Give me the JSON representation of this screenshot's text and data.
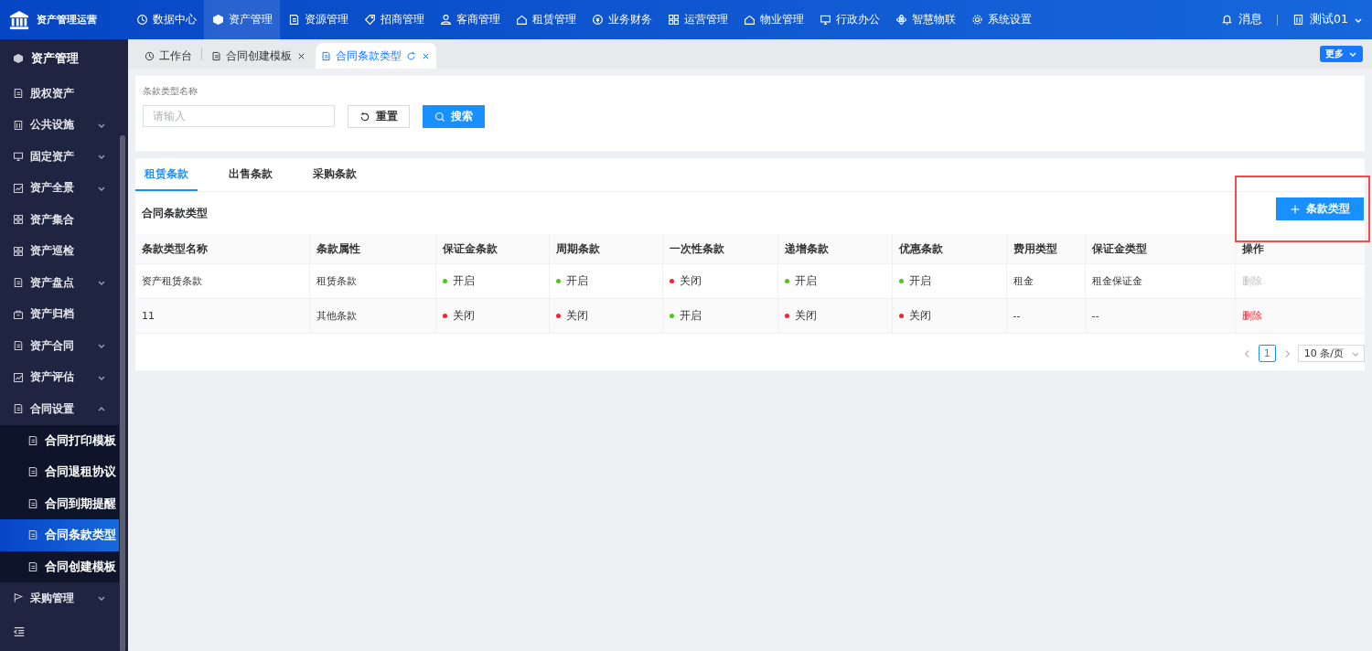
{
  "app": {
    "title": "资产管理运营"
  },
  "top_nav": [
    {
      "label": "数据中心",
      "selected": false
    },
    {
      "label": "资产管理",
      "selected": true
    },
    {
      "label": "资源管理",
      "selected": false
    },
    {
      "label": "招商管理",
      "selected": false
    },
    {
      "label": "客商管理",
      "selected": false
    },
    {
      "label": "租赁管理",
      "selected": false
    },
    {
      "label": "业务财务",
      "selected": false
    },
    {
      "label": "运营管理",
      "selected": false
    },
    {
      "label": "物业管理",
      "selected": false
    },
    {
      "label": "行政办公",
      "selected": false
    },
    {
      "label": "智慧物联",
      "selected": false
    },
    {
      "label": "系统设置",
      "selected": false
    }
  ],
  "header_right": {
    "messages": "消息",
    "user": "测试01"
  },
  "sidebar": {
    "title": "资产管理",
    "items": [
      {
        "label": "股权资产",
        "kind": "link"
      },
      {
        "label": "公共设施",
        "kind": "group",
        "expanded": false
      },
      {
        "label": "固定资产",
        "kind": "group",
        "expanded": false
      },
      {
        "label": "资产全景",
        "kind": "group",
        "expanded": false
      },
      {
        "label": "资产集合",
        "kind": "link"
      },
      {
        "label": "资产巡检",
        "kind": "link"
      },
      {
        "label": "资产盘点",
        "kind": "group",
        "expanded": false
      },
      {
        "label": "资产归档",
        "kind": "link"
      },
      {
        "label": "资产合同",
        "kind": "group",
        "expanded": false
      },
      {
        "label": "资产评估",
        "kind": "group",
        "expanded": false
      },
      {
        "label": "合同设置",
        "kind": "group",
        "expanded": true,
        "children": [
          {
            "label": "合同打印模板",
            "selected": false
          },
          {
            "label": "合同退租协议",
            "selected": false
          },
          {
            "label": "合同到期提醒",
            "selected": false
          },
          {
            "label": "合同条款类型",
            "selected": true
          },
          {
            "label": "合同创建模板",
            "selected": false
          }
        ]
      },
      {
        "label": "采购管理",
        "kind": "group",
        "expanded": false
      }
    ]
  },
  "page_tabs": [
    {
      "label": "工作台",
      "selected": false,
      "closable": false
    },
    {
      "label": "合同创建模板",
      "selected": false,
      "closable": true
    },
    {
      "label": "合同条款类型",
      "selected": true,
      "closable": true
    }
  ],
  "more_button": "更多",
  "search": {
    "label": "条款类型名称",
    "placeholder": "请输入",
    "reset": "重置",
    "submit": "搜索"
  },
  "clause_tabs": [
    {
      "label": "租赁条款",
      "selected": true
    },
    {
      "label": "出售条款",
      "selected": false
    },
    {
      "label": "采购条款",
      "selected": false
    }
  ],
  "table": {
    "title": "合同条款类型",
    "add_button": "条款类型",
    "columns": [
      "条款类型名称",
      "条款属性",
      "保证金条款",
      "周期条款",
      "一次性条款",
      "递增条款",
      "优惠条款",
      "费用类型",
      "保证金类型",
      "操作"
    ],
    "rows": [
      {
        "cells": [
          {
            "kind": "text",
            "text": "资产租赁条款"
          },
          {
            "kind": "text",
            "text": "租赁条款"
          },
          {
            "kind": "status",
            "text": "开启",
            "on": true
          },
          {
            "kind": "status",
            "text": "开启",
            "on": true
          },
          {
            "kind": "status",
            "text": "关闭",
            "on": false
          },
          {
            "kind": "status",
            "text": "开启",
            "on": true
          },
          {
            "kind": "status",
            "text": "开启",
            "on": true
          },
          {
            "kind": "text",
            "text": "租金"
          },
          {
            "kind": "text",
            "text": "租金保证金"
          },
          {
            "kind": "action",
            "text": "删除",
            "disabled": true
          }
        ]
      },
      {
        "cells": [
          {
            "kind": "text",
            "text": "11"
          },
          {
            "kind": "text",
            "text": "其他条款"
          },
          {
            "kind": "status",
            "text": "关闭",
            "on": false
          },
          {
            "kind": "status",
            "text": "关闭",
            "on": false
          },
          {
            "kind": "status",
            "text": "开启",
            "on": true
          },
          {
            "kind": "status",
            "text": "关闭",
            "on": false
          },
          {
            "kind": "status",
            "text": "关闭",
            "on": false
          },
          {
            "kind": "text",
            "text": "--"
          },
          {
            "kind": "text",
            "text": "--"
          },
          {
            "kind": "action",
            "text": "删除",
            "disabled": false
          }
        ]
      }
    ]
  },
  "pagination": {
    "page": "1",
    "page_size": "10 条/页"
  }
}
